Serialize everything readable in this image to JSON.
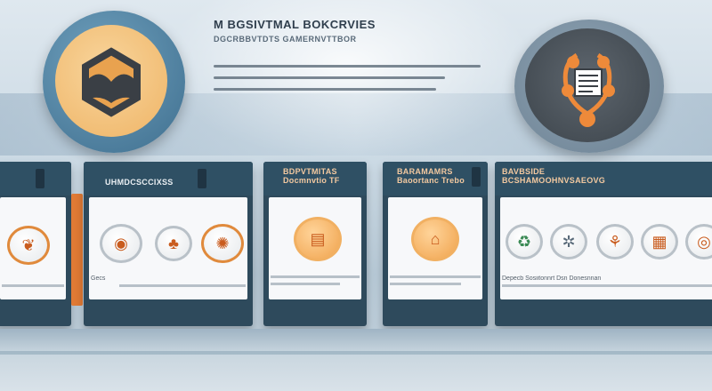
{
  "header": {
    "title": "M BGSIVTMAL BOKCRVIES",
    "subtitle": "DGCRBBVTDTS GAMERNVTTBOR"
  },
  "panels": [
    {
      "title": "",
      "caption": "",
      "icons": [
        "leaf-icon"
      ]
    },
    {
      "title": "UHMDCSCCIXSS",
      "caption": "Gecs",
      "icons": [
        "eye-icon",
        "tree-icon",
        "sunburst-icon"
      ]
    },
    {
      "title": "BDPVTMITAS\nDocmnvtio  TF",
      "caption": "",
      "icons": [
        "document-icon"
      ]
    },
    {
      "title": "BARAMAMRS\nBaoortanc Trebo",
      "caption": "",
      "icons": [
        "mushroom-icon"
      ]
    },
    {
      "title": "BAVBSIDE\nBCSHAMOOHNVSAEOVG",
      "caption": "Depecb  Sosiitonnrt  Dsn  Donesnnan",
      "icons": [
        "recycle-icon",
        "gear-icon",
        "plant-icon",
        "box-icon",
        "target-icon"
      ]
    }
  ],
  "colors": {
    "accent": "#e07a35",
    "panel": "#2e4a5c",
    "body": "#f7f8fa"
  }
}
